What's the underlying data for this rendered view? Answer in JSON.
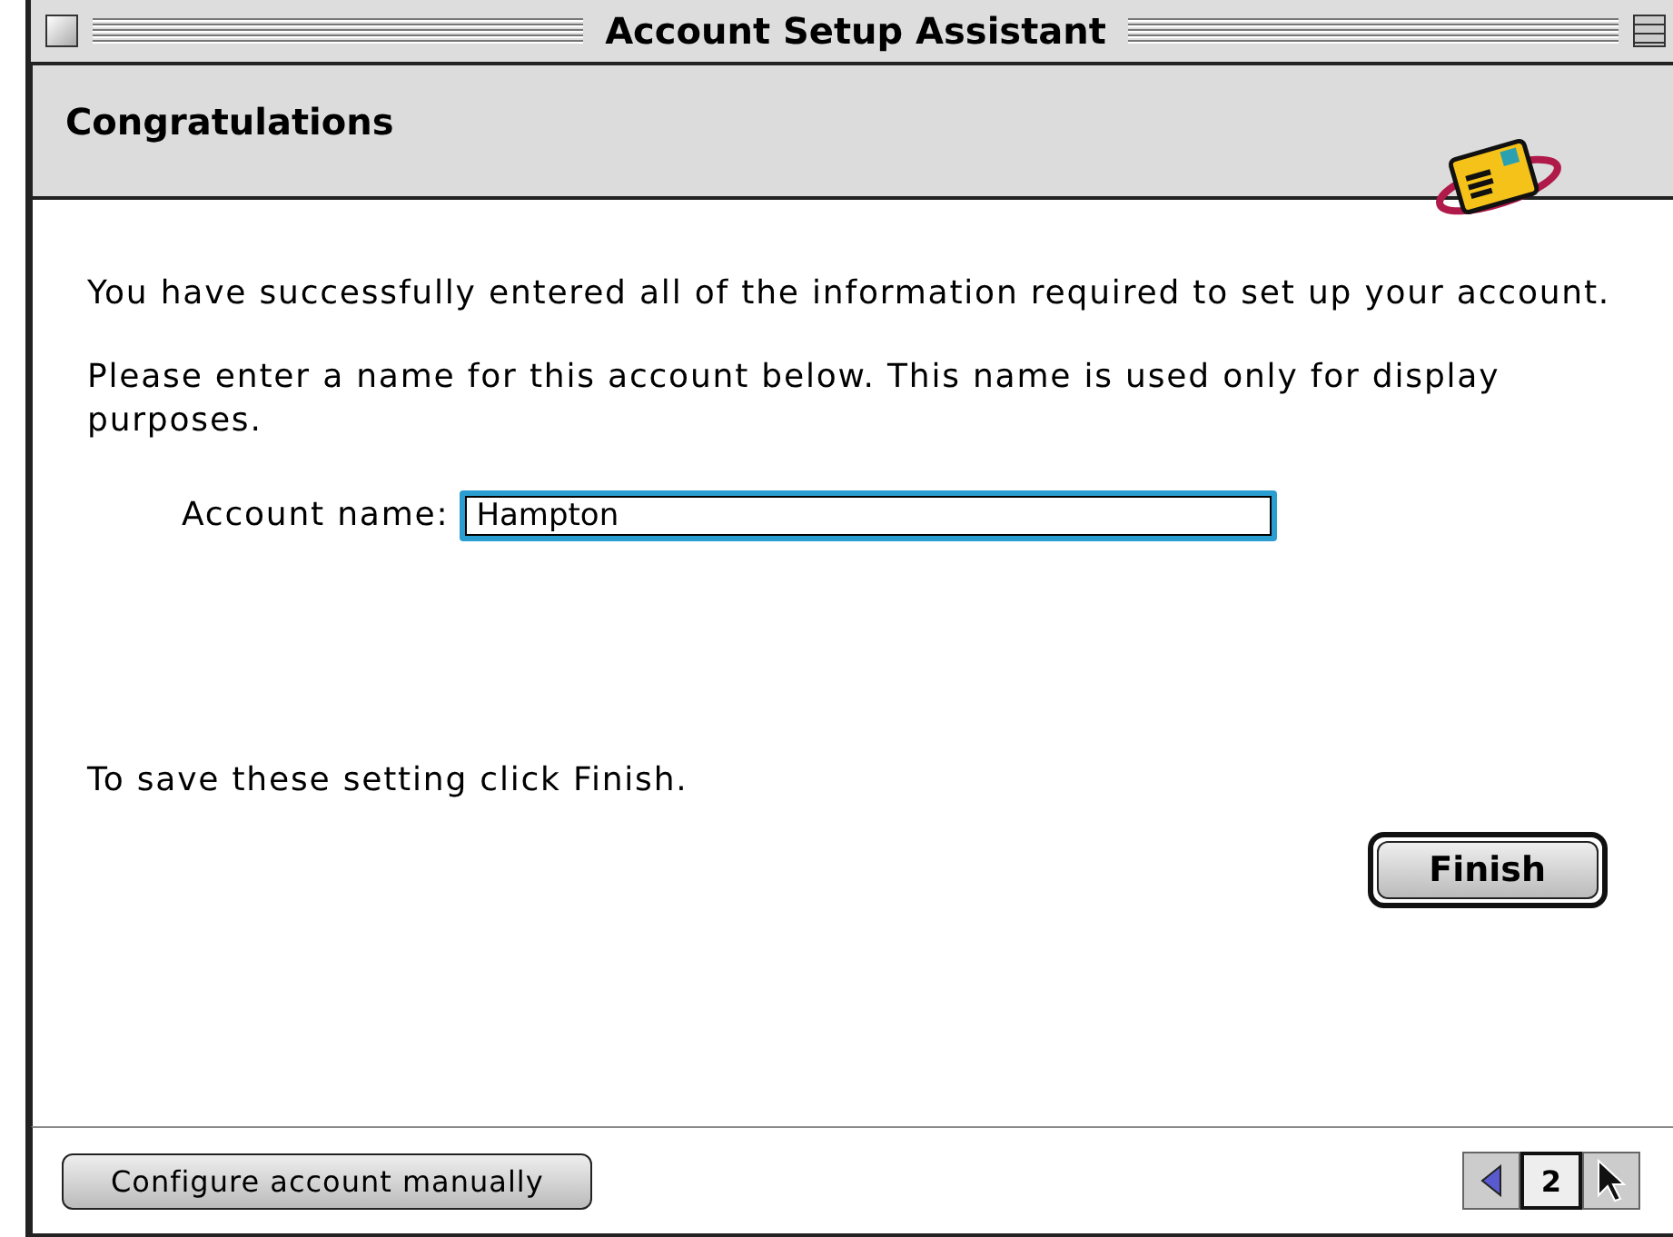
{
  "window": {
    "title": "Account Setup Assistant"
  },
  "header": {
    "title": "Congratulations"
  },
  "paragraphs": [
    "You have successfully entered all of the information required to set up your account.",
    "Please enter a name for this account below. This name is used only for display purposes."
  ],
  "account_name": {
    "label": "Account name:",
    "value": "Hampton",
    "focused": true
  },
  "save_hint": "To save these setting click Finish.",
  "finish_button": {
    "label": "Finish",
    "default": true
  },
  "footer": {
    "manual_button": "Configure account manually",
    "page": "2"
  }
}
